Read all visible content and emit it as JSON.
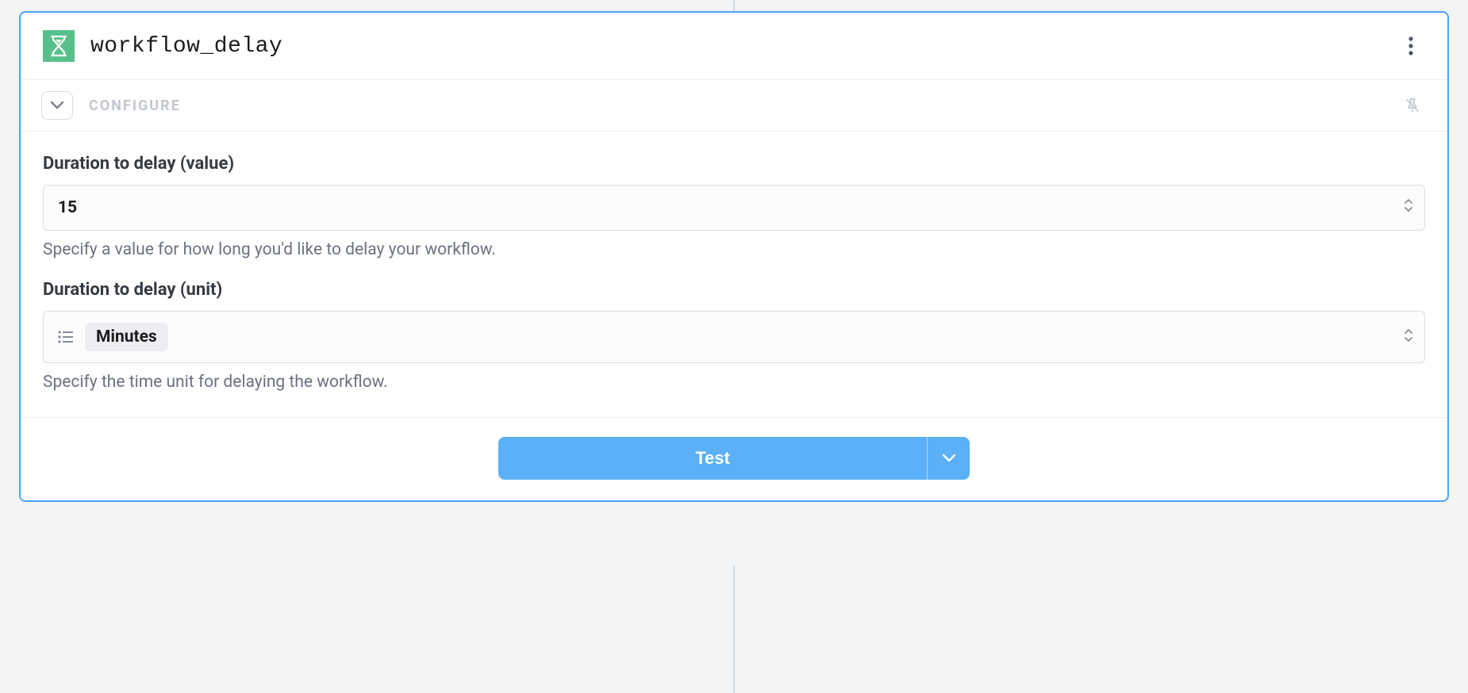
{
  "header": {
    "title": "workflow_delay"
  },
  "configure": {
    "label": "CONFIGURE"
  },
  "fields": {
    "duration_value": {
      "label": "Duration to delay (value)",
      "value": "15",
      "help": "Specify a value for how long you'd like to delay your workflow."
    },
    "duration_unit": {
      "label": "Duration to delay (unit)",
      "value": "Minutes",
      "help": "Specify the time unit for delaying the workflow."
    }
  },
  "footer": {
    "test_label": "Test"
  }
}
